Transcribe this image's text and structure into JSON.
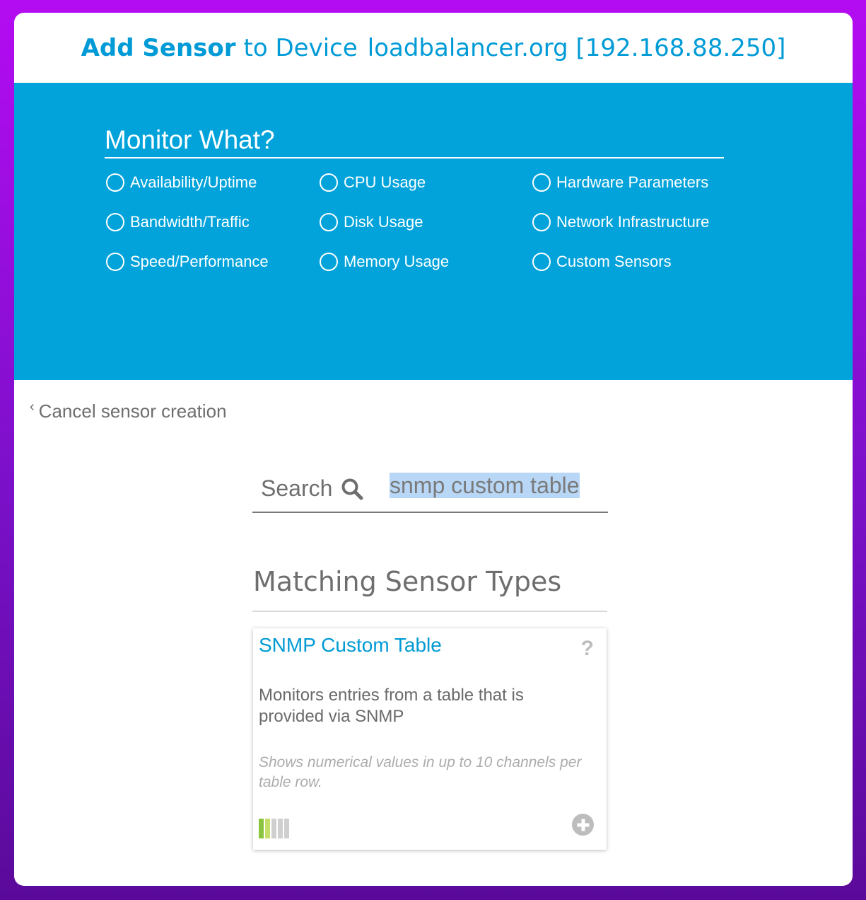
{
  "header": {
    "title_strong": "Add Sensor",
    "title_to": "to Device",
    "device": "loadbalancer.org [192.168.88.250]"
  },
  "monitor": {
    "title": "Monitor What?",
    "options": [
      "Availability/Uptime",
      "Bandwidth/Traffic",
      "Speed/Performance",
      "CPU Usage",
      "Disk Usage",
      "Memory Usage",
      "Hardware Parameters",
      "Network Infrastructure",
      "Custom Sensors"
    ]
  },
  "cancel": {
    "label": "Cancel sensor creation"
  },
  "search": {
    "label": "Search",
    "value": "snmp custom table"
  },
  "results": {
    "heading": "Matching Sensor Types",
    "cards": [
      {
        "title": "SNMP Custom Table",
        "help": "?",
        "description": "Monitors entries from a table that is provided via SNMP",
        "note": "Shows numerical values in up to 10 channels per table row.",
        "performance_impact_level": 2,
        "performance_impact_max": 5
      }
    ]
  },
  "colors": {
    "accent": "#02a3da",
    "title_blue": "#009bd6",
    "frame_gradient_top": "#b40cf2",
    "frame_gradient_bottom": "#5a0a9a",
    "impact_green": "#8bc53f",
    "search_highlight": "#b8d7f6"
  },
  "icons": {
    "search": "search-icon",
    "back": "chevron-left-icon",
    "help": "help-icon",
    "add": "plus-circle-icon"
  }
}
